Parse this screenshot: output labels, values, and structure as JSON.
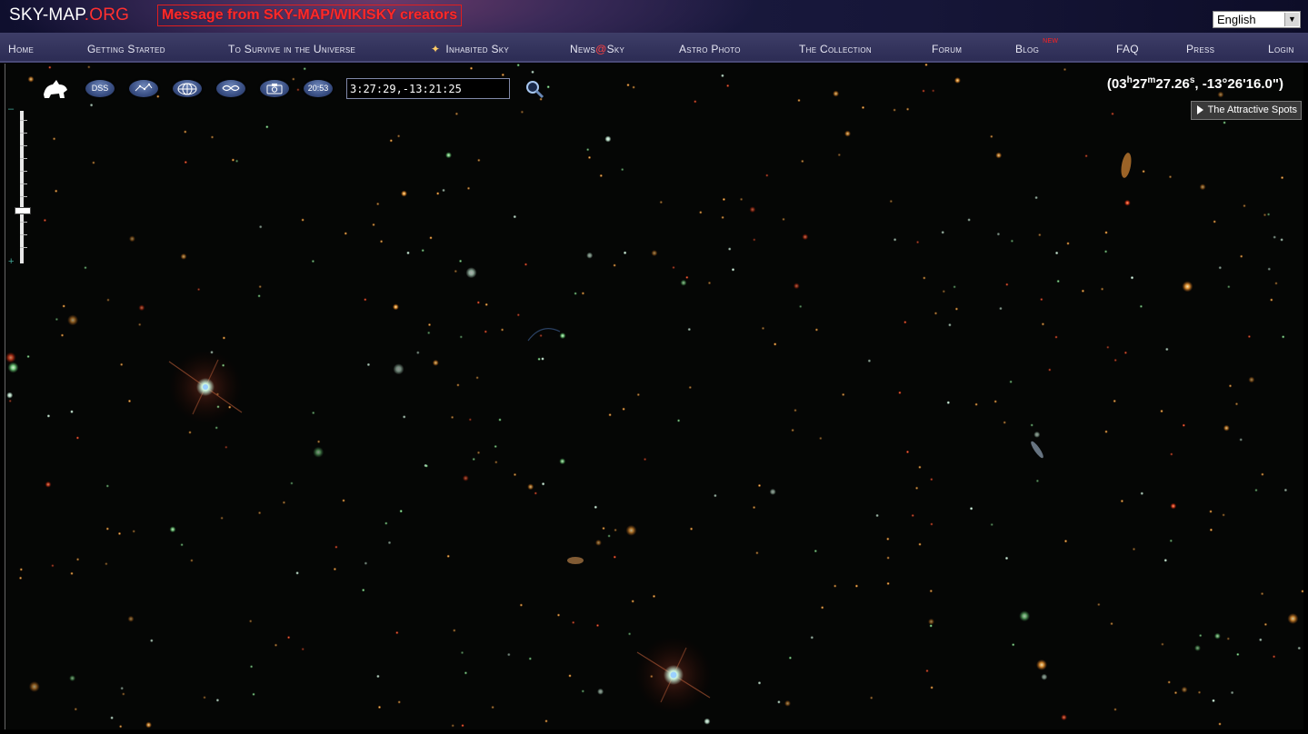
{
  "header": {
    "logo_part1": "SKY-MAP",
    "logo_part2": ".ORG",
    "message": "Message from SKY-MAP/WIKISKY creators",
    "language": "English"
  },
  "nav": {
    "home": "Home",
    "getting_started": "Getting Started",
    "survive": "To Survive in the Universe",
    "inhabited_sky": "Inhabited Sky",
    "news_a": "News",
    "news_at": "@",
    "news_b": "Sky",
    "astro_photo": "Astro Photo",
    "collection": "The Collection",
    "forum": "Forum",
    "blog": "Blog",
    "blog_badge": "NEW",
    "faq": "FAQ",
    "press": "Press",
    "login": "Login"
  },
  "toolbar": {
    "dss_label": "DSS",
    "time_label": "20:53",
    "coord_input_value": "3:27:29,-13:21:25"
  },
  "coords": {
    "ra_h": "03",
    "ra_m": "27",
    "ra_s": "27.26",
    "dec": ", -13°26'16.0\")",
    "open": "("
  },
  "attractive_spots": "The Attractive Spots",
  "colors": {
    "accent_red": "#ff3030",
    "nav_bg": "#34345c",
    "sky_bg": "#050605"
  },
  "icons": [
    "dog-icon",
    "constellation-icon",
    "grid-icon",
    "galaxy-icon",
    "camera-icon",
    "search-icon"
  ]
}
